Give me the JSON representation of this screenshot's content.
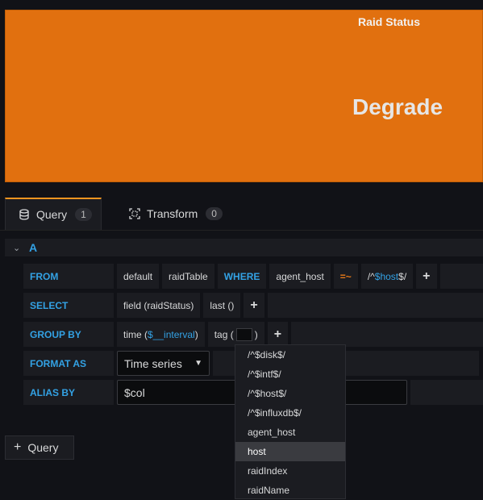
{
  "panel": {
    "title": "Raid Status",
    "value": "Degrade",
    "bg_color": "#e1700f"
  },
  "tabs": [
    {
      "label": "Query",
      "count": "1",
      "icon": "database-icon"
    },
    {
      "label": "Transform",
      "count": "0",
      "icon": "transform-icon"
    }
  ],
  "query": {
    "name": "A",
    "from": {
      "label": "FROM",
      "policy": "default",
      "measurement": "raidTable",
      "where_kw": "WHERE",
      "tag": "agent_host",
      "operator": "=~",
      "value_prefix": "/^",
      "value_var": "$host",
      "value_suffix": "$/"
    },
    "select": {
      "label": "SELECT",
      "field": "field (raidStatus)",
      "func": "last ()"
    },
    "group_by": {
      "label": "GROUP BY",
      "time_prefix": "time (",
      "time_var": "$__interval",
      "time_suffix": ")",
      "tag_prefix": "tag (",
      "tag_suffix": ")"
    },
    "format_as": {
      "label": "FORMAT AS",
      "value": "Time series"
    },
    "alias_by": {
      "label": "ALIAS BY",
      "value": "$col"
    }
  },
  "dropdown": {
    "items": [
      "/^$disk$/",
      "/^$intf$/",
      "/^$host$/",
      "/^$influxdb$/",
      "agent_host",
      "host",
      "raidIndex",
      "raidName"
    ],
    "selected": "host"
  },
  "add_query": {
    "label": "Query"
  }
}
